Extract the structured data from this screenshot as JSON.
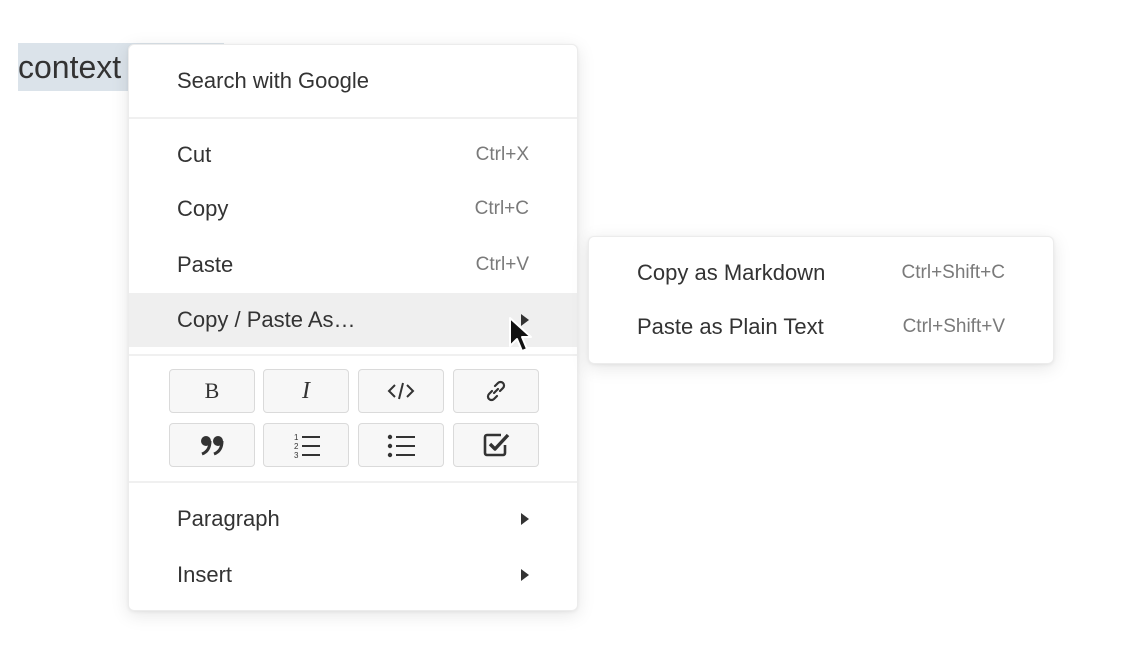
{
  "document": {
    "selected_text": "context"
  },
  "context_menu": {
    "search_label": "Search with Google",
    "cut": {
      "label": "Cut",
      "shortcut": "Ctrl+X"
    },
    "copy": {
      "label": "Copy",
      "shortcut": "Ctrl+C"
    },
    "paste": {
      "label": "Paste",
      "shortcut": "Ctrl+V"
    },
    "copy_paste_as": {
      "label": "Copy / Paste As…",
      "highlighted": true
    },
    "format_buttons": [
      {
        "name": "bold",
        "icon": "bold-icon"
      },
      {
        "name": "italic",
        "icon": "italic-icon"
      },
      {
        "name": "code",
        "icon": "code-icon"
      },
      {
        "name": "link",
        "icon": "link-icon"
      },
      {
        "name": "quote",
        "icon": "quote-icon"
      },
      {
        "name": "ordered-list",
        "icon": "ordered-list-icon"
      },
      {
        "name": "bullet-list",
        "icon": "bullet-list-icon"
      },
      {
        "name": "task-list",
        "icon": "checkbox-icon"
      }
    ],
    "paragraph": {
      "label": "Paragraph"
    },
    "insert": {
      "label": "Insert"
    }
  },
  "submenu": {
    "copy_markdown": {
      "label": "Copy as Markdown",
      "shortcut": "Ctrl+Shift+C"
    },
    "paste_plain": {
      "label": "Paste as Plain Text",
      "shortcut": "Ctrl+Shift+V"
    }
  },
  "colors": {
    "selection": "#dbe3ea",
    "highlight": "#efefef",
    "text": "#333333",
    "shortcut": "#7a7a7a"
  }
}
